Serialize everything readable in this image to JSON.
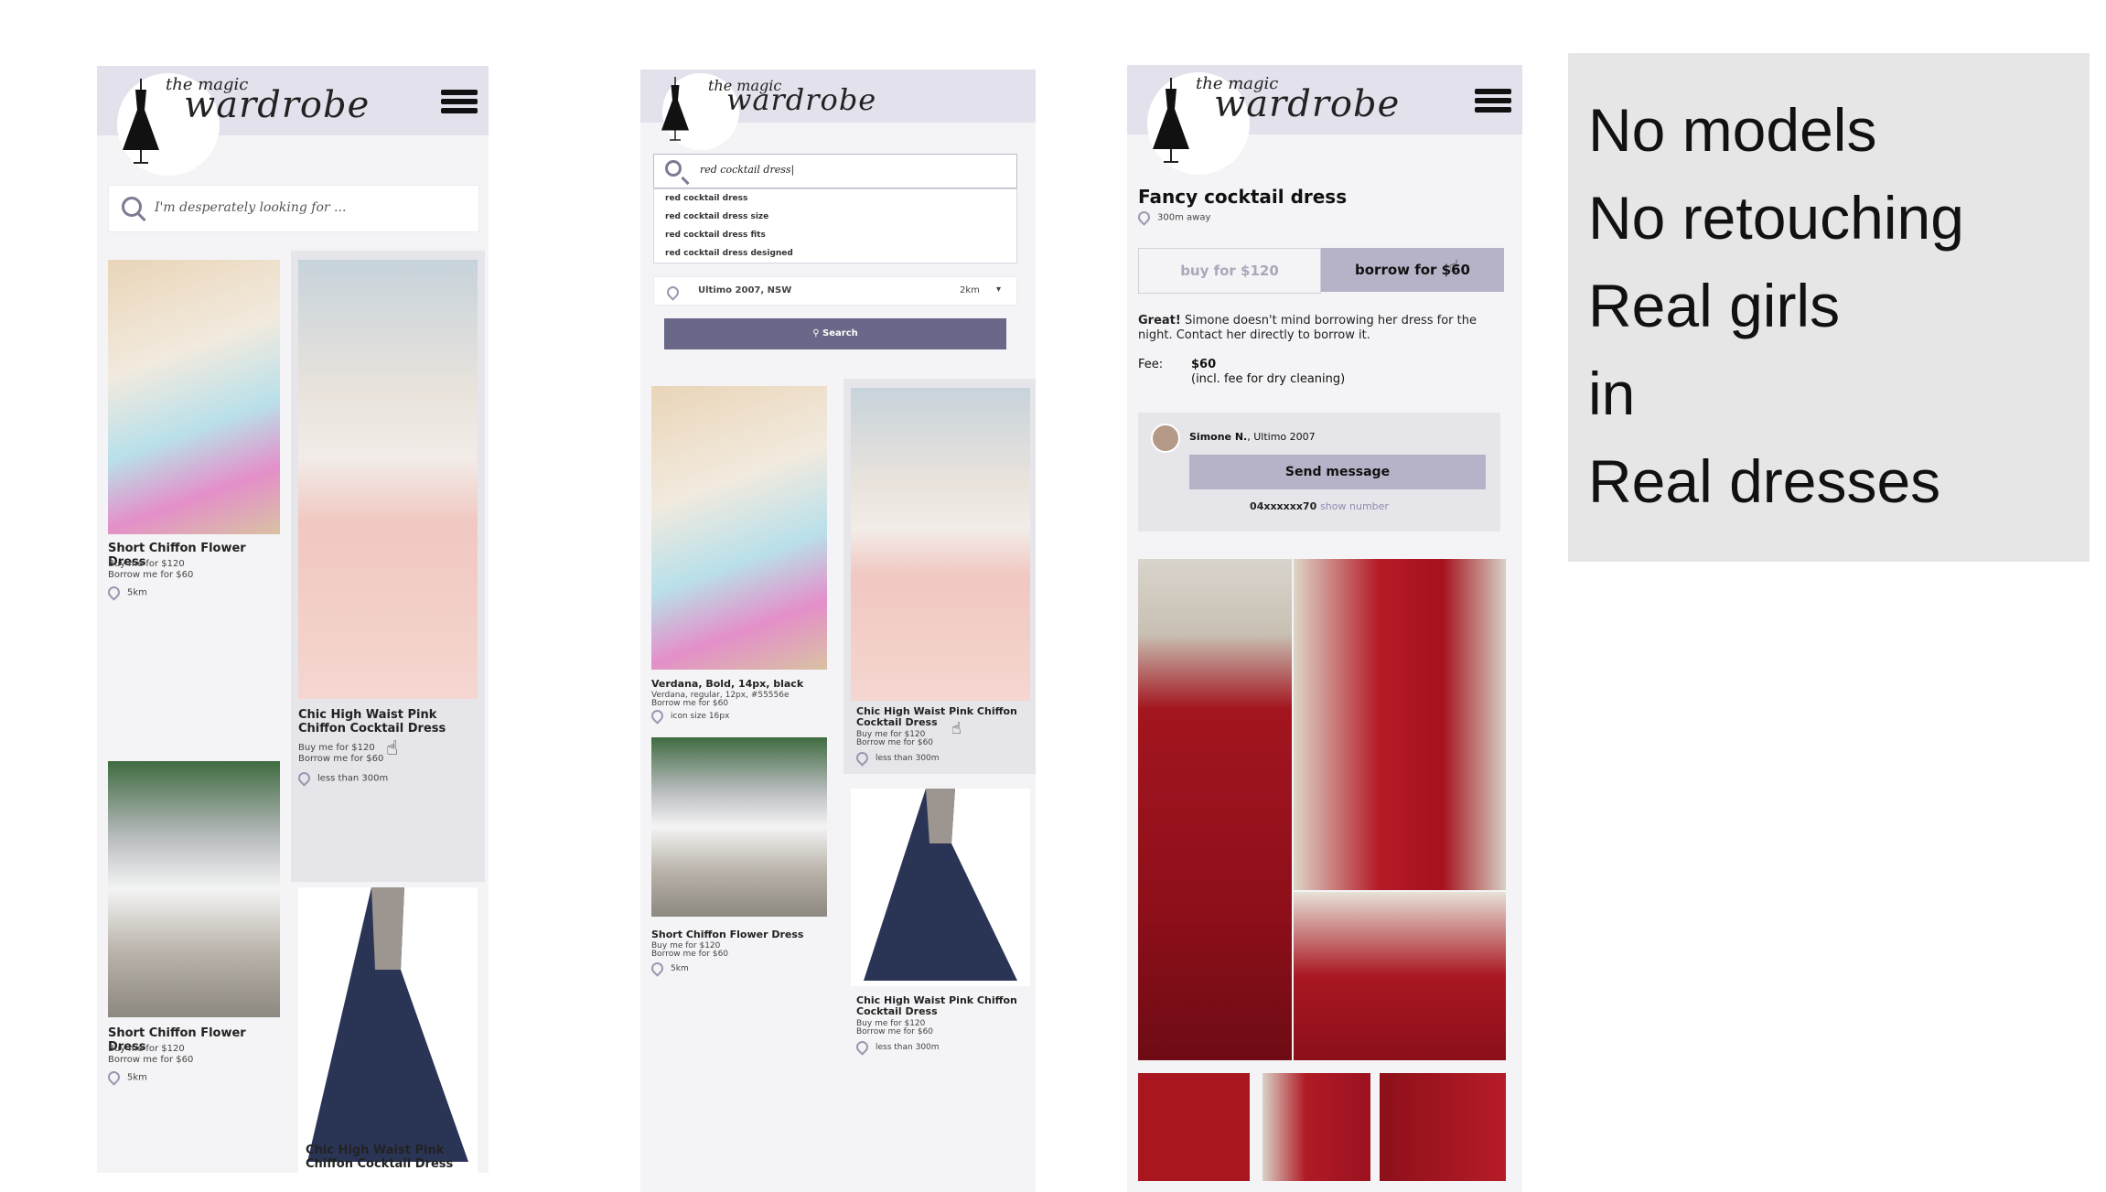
{
  "brand": {
    "small": "the magic",
    "big": "wardrobe"
  },
  "screen1": {
    "search_placeholder": "I'm desperately looking for ...",
    "items": [
      {
        "title": "Short Chiffon Flower Dress",
        "buy": "Buy me for $120",
        "borrow": "Borrow me for $60",
        "distance": "5km"
      },
      {
        "title": "Chic High Waist Pink Chiffon Cocktail Dress",
        "buy": "Buy me for $120",
        "borrow": "Borrow me for $60",
        "distance": "less than 300m"
      },
      {
        "title": "Short Chiffon Flower Dress",
        "buy": "Buy me for $120",
        "borrow": "Borrow me for $60",
        "distance": "5km"
      },
      {
        "title": "Chic High Waist Pink Chiffon Cocktail Dress"
      }
    ]
  },
  "screen2": {
    "search_value": "red cocktail dress|",
    "suggestions": [
      "red cocktail dress",
      "red cocktail dress size",
      "red cocktail dress fits",
      "red cocktail dress designed"
    ],
    "location_value": "Ultimo 2007, NSW",
    "radius_value": "2km",
    "search_button": "Search",
    "items": [
      {
        "title": "Verdana, Bold, 14px, black",
        "sub": "Verdana, regular, 12px, #55556e",
        "sub2": "Borrow me for $60",
        "distance": "icon size 16px"
      },
      {
        "title": "Chic High Waist Pink Chiffon Cocktail Dress",
        "buy": "Buy me for $120",
        "borrow": "Borrow me for $60",
        "distance": "less than 300m"
      },
      {
        "title": "Short Chiffon Flower Dress",
        "buy": "Buy me for $120",
        "borrow": "Borrow me for $60",
        "distance": "5km"
      },
      {
        "title": "Chic High Waist Pink Chiffon Cocktail Dress",
        "buy": "Buy me for $120",
        "borrow": "Borrow me for $60",
        "distance": "less than 300m"
      }
    ]
  },
  "screen3": {
    "title": "Fancy cocktail dress",
    "distance": "300m away",
    "buy_tab": "buy for $120",
    "borrow_tab": "borrow for $60",
    "info_bold": "Great!",
    "info_text": " Simone doesn't mind borrowing her dress for the night. Contact her directly to borrow it.",
    "fee_label": "Fee:",
    "fee_value": "$60",
    "fee_note": "(incl. fee for dry cleaning)",
    "contact_name": "Simone N.",
    "contact_location": ", Ultimo 2007",
    "send_button": "Send message",
    "phone_masked": "04xxxxxx70",
    "show_number": "show number"
  },
  "panel": {
    "lines": [
      "No models",
      "No retouching",
      "Real girls",
      "in",
      "Real dresses"
    ]
  },
  "colors": {
    "header": "#e3e1ec",
    "accent": "#6a6888",
    "button": "#b6b3c8"
  }
}
